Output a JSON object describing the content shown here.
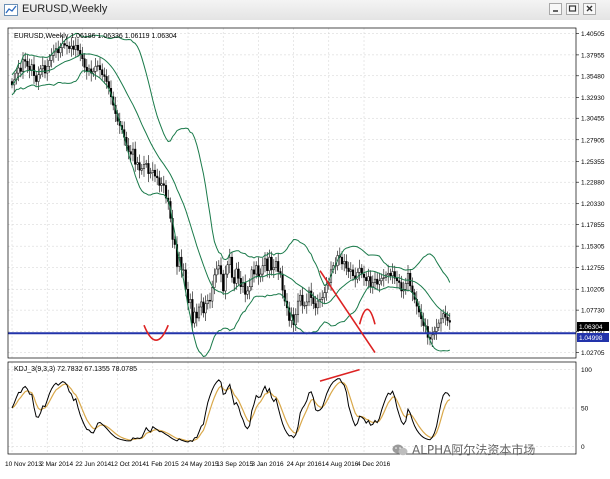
{
  "window": {
    "title": "EURUSD,Weekly",
    "buttons": [
      "minimize",
      "maximize",
      "close"
    ]
  },
  "watermark": {
    "text": "ALPHA阿尔法资本市场",
    "icon": "wechat-icon"
  },
  "colors": {
    "background": "#ffffff",
    "grid": "#d0d0d0",
    "candles": "#000000",
    "bollinger": "#1a7a4a",
    "support_line": "#2233aa",
    "trend_line": "#dd2222",
    "kdj_k": "#000000",
    "kdj_d": "#d9a84a",
    "price_label_bg": "#000000",
    "support_label_bg": "#2233aa"
  },
  "chart_data": {
    "type": "candlestick",
    "symbol": "EURUSD,Weekly",
    "ohlc_header": "EURUSD,Weekly 1.06186 1.06336 1.06119 1.06304",
    "ohlc": {
      "open": 1.06186,
      "high": 1.06336,
      "low": 1.06119,
      "close": 1.06304
    },
    "current_price": 1.06304,
    "support_level": 1.04998,
    "y_axis_ticks": [
      1.40505,
      1.37955,
      1.3548,
      1.3293,
      1.30455,
      1.27905,
      1.25355,
      1.2288,
      1.2033,
      1.17855,
      1.15305,
      1.12755,
      1.10205,
      1.0773,
      1.0518,
      1.02705
    ],
    "ylim": [
      1.0206,
      1.4114
    ],
    "x_axis_labels": [
      "10 Nov 2013",
      "2 Mar 2014",
      "22 Jun 2014",
      "12 Oct 2014",
      "1 Feb 2015",
      "24 May 2015",
      "13 Sep 2015",
      "3 Jan 2016",
      "24 Apr 2016",
      "14 Aug 2016",
      "4 Dec 2016"
    ],
    "grid": true,
    "bollinger_bands": true,
    "series": {
      "close": [
        1.344,
        1.35,
        1.358,
        1.364,
        1.36,
        1.374,
        1.372,
        1.366,
        1.361,
        1.368,
        1.355,
        1.348,
        1.356,
        1.363,
        1.367,
        1.358,
        1.366,
        1.373,
        1.379,
        1.383,
        1.387,
        1.382,
        1.388,
        1.393,
        1.391,
        1.39,
        1.387,
        1.39,
        1.386,
        1.391,
        1.385,
        1.38,
        1.375,
        1.365,
        1.36,
        1.363,
        1.358,
        1.36,
        1.366,
        1.367,
        1.362,
        1.356,
        1.354,
        1.348,
        1.34,
        1.33,
        1.32,
        1.31,
        1.301,
        1.296,
        1.291,
        1.282,
        1.272,
        1.265,
        1.262,
        1.268,
        1.25,
        1.252,
        1.243,
        1.245,
        1.25,
        1.251,
        1.239,
        1.24,
        1.243,
        1.236,
        1.234,
        1.225,
        1.227,
        1.225,
        1.21,
        1.206,
        1.186,
        1.161,
        1.155,
        1.129,
        1.14,
        1.125,
        1.125,
        1.102,
        1.086,
        1.09,
        1.062,
        1.075,
        1.068,
        1.081,
        1.087,
        1.074,
        1.085,
        1.089,
        1.088,
        1.104,
        1.119,
        1.126,
        1.13,
        1.12,
        1.1,
        1.12,
        1.131,
        1.14,
        1.116,
        1.109,
        1.126,
        1.115,
        1.105,
        1.11,
        1.096,
        1.1,
        1.105,
        1.125,
        1.12,
        1.13,
        1.117,
        1.12,
        1.13,
        1.138,
        1.124,
        1.14,
        1.125,
        1.128,
        1.135,
        1.123,
        1.12,
        1.101,
        1.088,
        1.08,
        1.065,
        1.072,
        1.06,
        1.072,
        1.088,
        1.095,
        1.083,
        1.083,
        1.087,
        1.1,
        1.092,
        1.085,
        1.08,
        1.088,
        1.09,
        1.092,
        1.098,
        1.107,
        1.11,
        1.125,
        1.13,
        1.13,
        1.142,
        1.14,
        1.132,
        1.135,
        1.127,
        1.123,
        1.125,
        1.118,
        1.114,
        1.122,
        1.127,
        1.12,
        1.116,
        1.112,
        1.117,
        1.105,
        1.11,
        1.114,
        1.108,
        1.112,
        1.115,
        1.116,
        1.119,
        1.121,
        1.118,
        1.123,
        1.115,
        1.112,
        1.11,
        1.1,
        1.102,
        1.109,
        1.121,
        1.106,
        1.098,
        1.09,
        1.082,
        1.075,
        1.067,
        1.059,
        1.058,
        1.045,
        1.043,
        1.048,
        1.052,
        1.057,
        1.062,
        1.067,
        1.073,
        1.069,
        1.065,
        1.063
      ]
    },
    "indicator": {
      "name": "KDJ",
      "label": "KDJ_3(9,3,3) 72.7832 67.1355 78.0785",
      "values": {
        "k": 72.7832,
        "d": 67.1355,
        "j": 78.0785
      },
      "y_ticks": [
        100,
        50,
        0
      ],
      "ylim": [
        -10,
        110
      ]
    },
    "annotations": [
      {
        "type": "horizontal_line",
        "label": "support",
        "y": 1.04998
      },
      {
        "type": "trend_line",
        "label": "descending resistance",
        "x": [
          "17 Jul 2016",
          "8 Jan 2017"
        ],
        "y": [
          1.124,
          1.027
        ]
      },
      {
        "type": "trend_line",
        "label": "KDJ divergence",
        "x": [
          "17 Jul 2016",
          "20 Nov 2016"
        ],
        "y": [
          85,
          100
        ]
      },
      {
        "type": "arc",
        "label": "double bottom",
        "x": [
          "4 Jan 2015",
          "22 Mar 2015"
        ],
        "y": 1.04998
      },
      {
        "type": "arc",
        "label": "current arc",
        "x": [
          "20 Nov 2016",
          "8 Jan 2017"
        ],
        "y": 1.07
      }
    ]
  }
}
